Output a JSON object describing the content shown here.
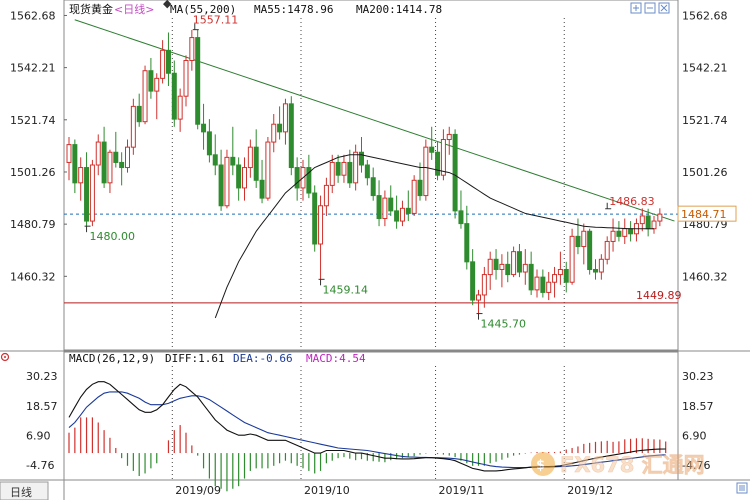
{
  "header": {
    "instrument": "现货黄金",
    "period": "<日线>",
    "ma_text": "MA(55,200)",
    "ma55_text": "MA55:1478.96",
    "ma200_text": "MA200:1414.78"
  },
  "macd_header": {
    "params": "MACD(26,12,9)",
    "diff": "DIFF:1.61",
    "dea": "DEA:-0.66",
    "macd": "MACD:4.54"
  },
  "footer": {
    "period_tab": "日线",
    "watermark": "FX678 汇通网"
  },
  "toolbar": {
    "icons": [
      "expand-icon",
      "minus-icon",
      "close-icon",
      "menu-icon"
    ]
  },
  "colors": {
    "up": "#d0312d",
    "down": "#2e8b2e",
    "ma55": "#1a1a1a",
    "trendline": "#2e7d32",
    "support": "#b71c1c",
    "dashed": "#1f6fb5",
    "diff": "#111111",
    "dea": "#1a3a9a",
    "grid": "#444444"
  },
  "chart_data": {
    "type": "candlestick",
    "title": "现货黄金 日线",
    "ylim": [
      1442,
      1566
    ],
    "y_ticks": [
      1562.68,
      1542.21,
      1521.74,
      1501.26,
      1480.79,
      1460.32
    ],
    "y_tick_labels": [
      "1562.68",
      "1542.21",
      "1521.74",
      "1501.26",
      "1480.79",
      "1460.32"
    ],
    "x_labels": [
      "2019/09",
      "2019/10",
      "2019/11",
      "2019/12"
    ],
    "current_price": "1484.71",
    "annotations": [
      {
        "text": "1557.11",
        "color": "up"
      },
      {
        "text": "1480.00",
        "color": "down"
      },
      {
        "text": "1459.14",
        "color": "down"
      },
      {
        "text": "1445.70",
        "color": "down"
      },
      {
        "text": "1486.83",
        "color": "up"
      },
      {
        "text": "1449.89",
        "color": "support"
      }
    ],
    "support_level": 1449.89,
    "trendline": [
      [
        0.98,
        1561
      ],
      [
        103.5,
        1482
      ]
    ],
    "dashed_level": 1484.71,
    "candles": [
      [
        1505,
        1515,
        1498,
        1512
      ],
      [
        1512,
        1514,
        1493,
        1497
      ],
      [
        1497,
        1507,
        1490,
        1503
      ],
      [
        1503,
        1509,
        1480,
        1482
      ],
      [
        1482,
        1506,
        1480,
        1504
      ],
      [
        1504,
        1516,
        1500,
        1513
      ],
      [
        1513,
        1519,
        1495,
        1497
      ],
      [
        1497,
        1510,
        1493,
        1509
      ],
      [
        1509,
        1517,
        1503,
        1505
      ],
      [
        1505,
        1509,
        1496,
        1503
      ],
      [
        1503,
        1514,
        1501,
        1511
      ],
      [
        1511,
        1530,
        1508,
        1527
      ],
      [
        1527,
        1532,
        1519,
        1521
      ],
      [
        1521,
        1543,
        1520,
        1541
      ],
      [
        1541,
        1546,
        1530,
        1533
      ],
      [
        1533,
        1540,
        1522,
        1538
      ],
      [
        1538,
        1553,
        1536,
        1549
      ],
      [
        1549,
        1556,
        1535,
        1540
      ],
      [
        1540,
        1545,
        1519,
        1522
      ],
      [
        1522,
        1534,
        1517,
        1531
      ],
      [
        1531,
        1547,
        1527,
        1545
      ],
      [
        1545,
        1557,
        1541,
        1554
      ],
      [
        1554,
        1557,
        1518,
        1520
      ],
      [
        1520,
        1528,
        1510,
        1517
      ],
      [
        1517,
        1522,
        1505,
        1508
      ],
      [
        1508,
        1516,
        1500,
        1504
      ],
      [
        1504,
        1510,
        1486,
        1488
      ],
      [
        1488,
        1510,
        1487,
        1507
      ],
      [
        1507,
        1519,
        1500,
        1504
      ],
      [
        1504,
        1507,
        1490,
        1495
      ],
      [
        1495,
        1507,
        1490,
        1503
      ],
      [
        1503,
        1514,
        1499,
        1511
      ],
      [
        1511,
        1518,
        1495,
        1498
      ],
      [
        1498,
        1506,
        1489,
        1491
      ],
      [
        1491,
        1515,
        1490,
        1513
      ],
      [
        1513,
        1524,
        1509,
        1520
      ],
      [
        1520,
        1527,
        1514,
        1517
      ],
      [
        1517,
        1530,
        1512,
        1528
      ],
      [
        1528,
        1531,
        1500,
        1503
      ],
      [
        1503,
        1507,
        1490,
        1495
      ],
      [
        1495,
        1506,
        1490,
        1503
      ],
      [
        1503,
        1508,
        1491,
        1493
      ],
      [
        1493,
        1496,
        1470,
        1473
      ],
      [
        1473,
        1492,
        1459,
        1488
      ],
      [
        1488,
        1499,
        1484,
        1496
      ],
      [
        1496,
        1508,
        1493,
        1505
      ],
      [
        1505,
        1508,
        1497,
        1500
      ],
      [
        1500,
        1508,
        1497,
        1505
      ],
      [
        1505,
        1510,
        1495,
        1497
      ],
      [
        1497,
        1512,
        1494,
        1509
      ],
      [
        1509,
        1515,
        1501,
        1504
      ],
      [
        1504,
        1506,
        1496,
        1499
      ],
      [
        1499,
        1503,
        1490,
        1492
      ],
      [
        1492,
        1498,
        1480,
        1483
      ],
      [
        1483,
        1494,
        1480,
        1491
      ],
      [
        1491,
        1496,
        1484,
        1486
      ],
      [
        1486,
        1492,
        1479,
        1482
      ],
      [
        1482,
        1490,
        1480,
        1487
      ],
      [
        1487,
        1494,
        1482,
        1485
      ],
      [
        1485,
        1500,
        1484,
        1498
      ],
      [
        1498,
        1505,
        1490,
        1492
      ],
      [
        1492,
        1514,
        1490,
        1511
      ],
      [
        1511,
        1519,
        1506,
        1509
      ],
      [
        1509,
        1513,
        1498,
        1500
      ],
      [
        1500,
        1518,
        1498,
        1514
      ],
      [
        1514,
        1519,
        1508,
        1516
      ],
      [
        1516,
        1518,
        1483,
        1486
      ],
      [
        1486,
        1494,
        1479,
        1481
      ],
      [
        1481,
        1488,
        1463,
        1466
      ],
      [
        1466,
        1471,
        1449,
        1451
      ],
      [
        1451,
        1455,
        1445.7,
        1453
      ],
      [
        1453,
        1464,
        1448,
        1461
      ],
      [
        1461,
        1470,
        1455,
        1467
      ],
      [
        1467,
        1471,
        1459,
        1463
      ],
      [
        1463,
        1469,
        1456,
        1465
      ],
      [
        1465,
        1470,
        1458,
        1461
      ],
      [
        1461,
        1472,
        1460,
        1470
      ],
      [
        1470,
        1473,
        1460,
        1462
      ],
      [
        1462,
        1471,
        1457,
        1465
      ],
      [
        1465,
        1470,
        1453,
        1455
      ],
      [
        1455,
        1463,
        1452,
        1460
      ],
      [
        1460,
        1463,
        1452,
        1454
      ],
      [
        1454,
        1462,
        1451,
        1458
      ],
      [
        1458,
        1464,
        1452,
        1461
      ],
      [
        1461,
        1470,
        1457,
        1463
      ],
      [
        1463,
        1466,
        1454,
        1458
      ],
      [
        1458,
        1479,
        1457,
        1476
      ],
      [
        1476,
        1483,
        1469,
        1472
      ],
      [
        1472,
        1481,
        1465,
        1478
      ],
      [
        1478,
        1479,
        1461,
        1463
      ],
      [
        1463,
        1467,
        1459,
        1462
      ],
      [
        1462,
        1469,
        1459,
        1467
      ],
      [
        1467,
        1476,
        1465,
        1474
      ],
      [
        1474,
        1483,
        1470,
        1478
      ],
      [
        1478,
        1482,
        1474,
        1476
      ],
      [
        1476,
        1483,
        1473,
        1479
      ],
      [
        1479,
        1482,
        1474,
        1477
      ],
      [
        1477,
        1483,
        1474,
        1481
      ],
      [
        1481,
        1487,
        1478,
        1484
      ],
      [
        1484,
        1486.83,
        1476,
        1479
      ],
      [
        1479,
        1484,
        1477,
        1482
      ],
      [
        1482,
        1487,
        1480,
        1484.71
      ]
    ],
    "ma55": [
      null,
      null,
      null,
      null,
      null,
      null,
      null,
      null,
      null,
      null,
      null,
      null,
      null,
      null,
      null,
      null,
      null,
      null,
      null,
      null,
      null,
      null,
      null,
      null,
      null,
      1444,
      1450,
      1456,
      1461,
      1466,
      1470,
      1474,
      1478,
      1481,
      1484,
      1487,
      1490,
      1493,
      1495,
      1497,
      1499,
      1501,
      1503,
      1504,
      1505,
      1506,
      1507,
      1507.5,
      1508,
      1508,
      1508,
      1507.5,
      1507,
      1506.5,
      1506,
      1505.5,
      1505,
      1504.5,
      1504,
      1503.5,
      1503,
      1503,
      1502.5,
      1502,
      1501.5,
      1501,
      1500,
      1498.5,
      1497,
      1495.5,
      1494,
      1492.5,
      1491,
      1490,
      1489,
      1488,
      1487,
      1486,
      1485,
      1484.5,
      1484,
      1483.5,
      1483,
      1482.5,
      1482,
      1481.5,
      1481,
      1480.5,
      1480,
      1479.8,
      1479.6,
      1479.5,
      1479.4,
      1479.3,
      1479.2,
      1479.1,
      1479,
      1479,
      1478.96,
      1478.96,
      1478.96
    ],
    "macd_ylim": [
      -9,
      33
    ],
    "macd_y_ticks": [
      30.23,
      18.57,
      6.9,
      -4.76
    ],
    "macd_y_tick_labels": [
      "30.23",
      "18.57",
      "6.90",
      "-4.76"
    ],
    "diff": [
      14,
      18,
      22,
      25,
      27,
      28,
      28,
      27,
      25,
      23,
      21,
      19,
      17,
      16,
      16,
      17,
      19,
      22,
      25,
      27,
      26,
      24,
      22,
      19,
      16,
      13,
      11,
      9,
      8,
      7,
      7,
      7.5,
      7,
      6,
      5,
      5,
      5,
      5,
      4,
      3,
      2,
      1,
      0,
      0,
      1,
      1,
      1,
      1,
      0.5,
      0,
      0,
      -0.5,
      -1,
      -1.5,
      -2,
      -2,
      -2.2,
      -2.3,
      -2.3,
      -2.2,
      -2,
      -1.8,
      -1.8,
      -2,
      -2.2,
      -2.5,
      -3,
      -4,
      -5,
      -6,
      -6.5,
      -7,
      -7,
      -7,
      -6.8,
      -6.5,
      -6.2,
      -6,
      -5.8,
      -5.5,
      -5.4,
      -5.3,
      -5.3,
      -5.2,
      -5,
      -4.5,
      -4,
      -3.5,
      -3,
      -2.5,
      -2,
      -1.6,
      -1.2,
      -0.8,
      -0.4,
      0,
      0.4,
      0.8,
      1.1,
      1.3,
      1.5,
      1.55,
      1.61
    ],
    "dea": [
      10,
      12,
      15,
      18,
      20,
      22,
      23.5,
      24,
      24,
      24,
      23.5,
      22.5,
      21.5,
      20,
      19,
      19,
      19,
      19.5,
      20.5,
      21.5,
      22,
      22.5,
      22.5,
      22,
      21,
      19.5,
      18,
      16.5,
      15,
      13.5,
      12,
      11,
      10,
      9,
      8,
      7.5,
      7,
      6.5,
      6,
      5.5,
      5,
      4.5,
      4,
      3.5,
      3,
      2.5,
      2,
      1.8,
      1.6,
      1.4,
      1.2,
      1,
      0.6,
      0.2,
      -0.2,
      -0.6,
      -1,
      -1.3,
      -1.5,
      -1.6,
      -1.7,
      -1.7,
      -1.8,
      -1.8,
      -1.9,
      -2,
      -2.2,
      -2.5,
      -3,
      -3.5,
      -4,
      -4.5,
      -5,
      -5.3,
      -5.5,
      -5.6,
      -5.7,
      -5.7,
      -5.7,
      -5.6,
      -5.6,
      -5.5,
      -5.5,
      -5.4,
      -5.3,
      -5.2,
      -5,
      -4.8,
      -4.5,
      -4.2,
      -3.9,
      -3.6,
      -3.3,
      -3,
      -2.7,
      -2.4,
      -2.1,
      -1.8,
      -1.5,
      -1.2,
      -1,
      -0.8,
      -0.66
    ],
    "macd_hist": [
      8,
      10,
      14,
      14,
      14,
      12,
      9,
      6,
      2,
      -2,
      -5,
      -7,
      -9,
      -8,
      -6,
      -4,
      0,
      5,
      9,
      11,
      8,
      3,
      -1,
      -6,
      -10,
      -13,
      -14,
      -15,
      -14,
      -13,
      -10,
      -7,
      -6,
      -6,
      -6,
      -5,
      -4,
      -3,
      -4,
      -5,
      -6,
      -7,
      -8,
      -7,
      -4,
      -3,
      -2,
      -1.6,
      -2.2,
      -2.8,
      -2.4,
      -3,
      -3.2,
      -3.4,
      -3.6,
      -2.8,
      -2.4,
      -2,
      -1.6,
      -1.2,
      -0.6,
      -0.2,
      0,
      -0.4,
      -0.6,
      -1,
      -1.6,
      -3,
      -4,
      -5,
      -5,
      -5,
      -4,
      -3.4,
      -2.6,
      -1.8,
      -1,
      -0.6,
      -0.2,
      0.2,
      0.4,
      0.4,
      0.4,
      0.4,
      0.6,
      1.4,
      2,
      2.6,
      3.6,
      4,
      4.4,
      4.6,
      4.8,
      4.4,
      4.6,
      5.4,
      5.6,
      5.8,
      5.8,
      5.6,
      5.4,
      5.3,
      4.54
    ]
  }
}
